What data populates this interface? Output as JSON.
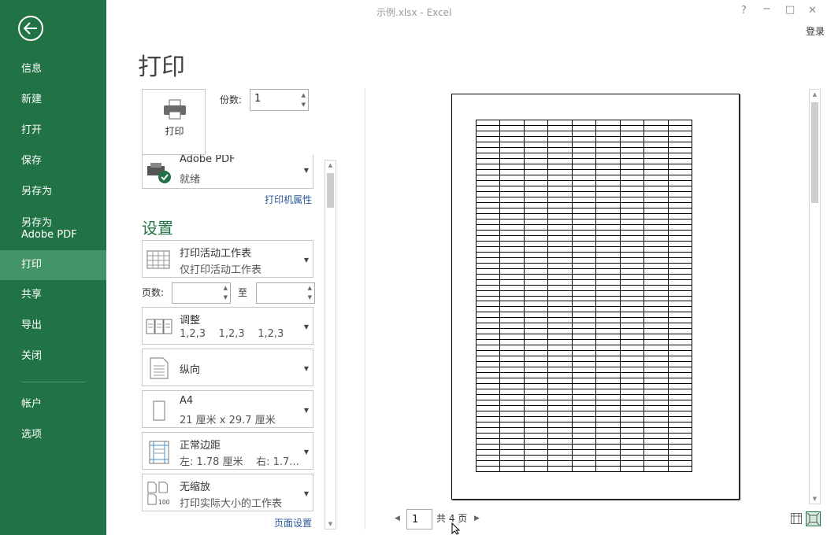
{
  "titlebar": {
    "title": "示例.xlsx - Excel",
    "help": "?",
    "minimize": "−",
    "maximize": "□",
    "close": "✕",
    "login": "登录"
  },
  "nav": {
    "items": [
      {
        "label": "信息"
      },
      {
        "label": "新建"
      },
      {
        "label": "打开"
      },
      {
        "label": "保存"
      },
      {
        "label": "另存为"
      },
      {
        "label": "另存为 Adobe PDF"
      },
      {
        "label": "打印",
        "active": true
      },
      {
        "label": "共享"
      },
      {
        "label": "导出"
      },
      {
        "label": "关闭"
      },
      {
        "label": "帐户"
      },
      {
        "label": "选项"
      }
    ]
  },
  "main": {
    "title": "打印",
    "print_button": "打印",
    "copies_label": "份数:",
    "copies_value": "1",
    "printer": {
      "name": "Adobe PDF",
      "status": "就绪",
      "properties_link": "打印机属性"
    },
    "settings_title": "设置",
    "settings": [
      {
        "line1": "打印活动工作表",
        "line2": "仅打印活动工作表",
        "icon": "sheet-grid-icon"
      },
      {
        "line1": "调整",
        "line2": "1,2,3    1,2,3    1,2,3",
        "icon": "collate-icon"
      },
      {
        "line1": "纵向",
        "line2": "",
        "icon": "portrait-icon"
      },
      {
        "line1": "A4",
        "line2": "21 厘米 x 29.7 厘米",
        "icon": "paper-size-icon"
      },
      {
        "line1": "正常边距",
        "line2": "左: 1.78 厘米    右: 1.7...",
        "icon": "margins-icon"
      },
      {
        "line1": "无缩放",
        "line2": "打印实际大小的工作表",
        "icon": "no-scaling-icon"
      }
    ],
    "pages_label": "页数:",
    "pages_to": "至",
    "page_from": "",
    "page_to": "",
    "page_setup_link": "页面设置"
  },
  "preview": {
    "current_page": "1",
    "total_label": "共 4 页"
  },
  "colors": {
    "accent": "#217346",
    "active_nav": "#439467",
    "link": "#2b579a"
  }
}
